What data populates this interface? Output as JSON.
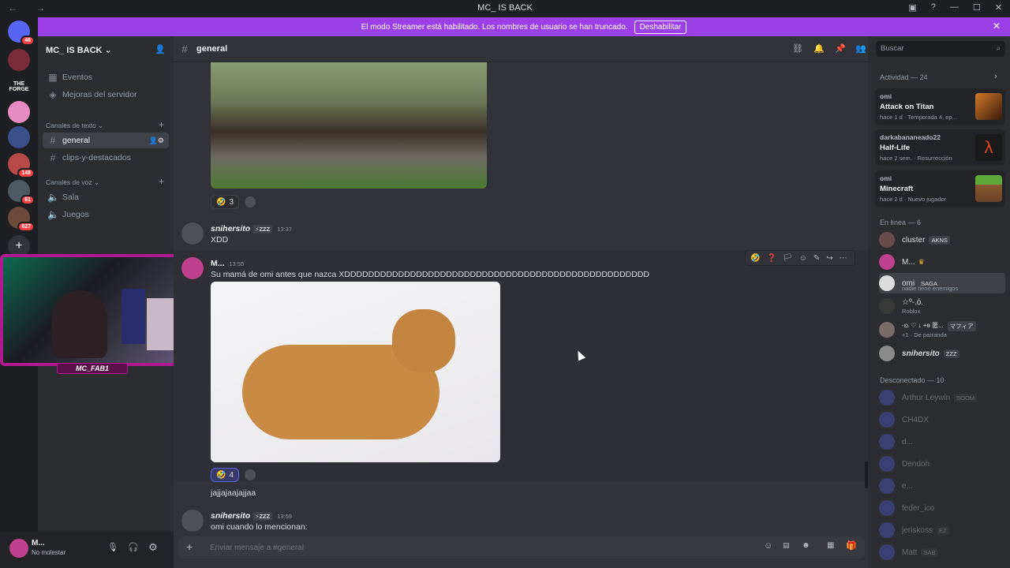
{
  "titlebar": {
    "title": "MC_ IS BACK",
    "nav": "← →"
  },
  "banner": {
    "text": "El modo Streamer está habilitado. Los nombres de usuario se han truncado.",
    "button": "Deshabilitar",
    "close": "✕"
  },
  "servers": [
    {
      "name": "home",
      "badge": "46"
    },
    {
      "name": "server-2",
      "badge": ""
    },
    {
      "name": "the-forge",
      "badge": "",
      "label": "THE FORGE"
    },
    {
      "name": "server-4",
      "badge": ""
    },
    {
      "name": "server-5",
      "badge": ""
    },
    {
      "name": "server-6",
      "badge": "148"
    },
    {
      "name": "server-7",
      "badge": "61"
    },
    {
      "name": "server-8",
      "badge": "627"
    }
  ],
  "sidebar": {
    "server_name": "MC_ IS BACK",
    "top_items": [
      {
        "label": "Eventos"
      },
      {
        "label": "Mejoras del servidor"
      }
    ],
    "text_category": "Canales de texto",
    "text_channels": [
      {
        "label": "general",
        "active": true
      },
      {
        "label": "clips-y-destacados",
        "active": false
      }
    ],
    "voice_category": "Canales de voz",
    "voice_channels": [
      {
        "label": "Sala"
      },
      {
        "label": "Juegos"
      }
    ]
  },
  "userbar": {
    "name": "M...",
    "status": "No molestar"
  },
  "stream_overlay": {
    "label": "MC_FAB1"
  },
  "chat": {
    "channel": "general",
    "reaction1": {
      "emoji": "🤣",
      "count": "3"
    },
    "msg1": {
      "author": "snihersito",
      "tag": "⚡ZZZ",
      "time": "13:37",
      "text": "XDD"
    },
    "msg2": {
      "author": "M...",
      "time": "13:55",
      "text": "Su mamá de omi antes que nazca XDDDDDDDDDDDDDDDDDDDDDDDDDDDDDDDDDDDDDDDDDDDDDDDDDDD"
    },
    "reaction2": {
      "emoji": "🤣",
      "count": "4"
    },
    "msg3": {
      "text": "jajjajaajajjaa"
    },
    "msg4": {
      "author": "snihersito",
      "tag": "⚡ZZZ",
      "time": "13:59",
      "text": "omi cuando lo mencionan:"
    },
    "composer_placeholder": "Enviar mensaje a #general"
  },
  "members": {
    "search_placeholder": "Buscar",
    "activity_label": "Actividad — 24",
    "activities": [
      {
        "user": "omi",
        "game": "Attack on Titan",
        "meta": "hace 1 d · Temporada 4, ep..."
      },
      {
        "user": "darkabananeado22",
        "game": "Half-Life",
        "meta": "hace 2 sem. · Resurrección"
      },
      {
        "user": "omi",
        "game": "Minecraft",
        "meta": "hace 2 d · Nuevo jugador"
      }
    ],
    "online_label": "En línea — 6",
    "online": [
      {
        "name": "cluster",
        "tag": "AKNS",
        "status": ""
      },
      {
        "name": "M...",
        "tag": "",
        "status": ""
      },
      {
        "name": "omi",
        "tag": "SAGA",
        "status": "nadie tiene enemigos"
      },
      {
        "name": "☆º-.ό.",
        "tag": "",
        "status": "Roblox"
      },
      {
        "name": "-ᨳ ♡ ↓ +ө 匿...",
        "tag": "マフィア",
        "status": "+1 · De parranda"
      },
      {
        "name": "snihersito",
        "tag": "ZZZ",
        "status": ""
      }
    ],
    "offline_label": "Desconectado — 10",
    "offline": [
      {
        "name": "Arthur Leywin",
        "tag": "BOOM"
      },
      {
        "name": "CH4DX",
        "tag": ""
      },
      {
        "name": "d...",
        "tag": ""
      },
      {
        "name": "Dendoh",
        "tag": ""
      },
      {
        "name": "e...",
        "tag": ""
      },
      {
        "name": "feder_ico",
        "tag": ""
      },
      {
        "name": "jeriskoss",
        "tag": "EZ"
      },
      {
        "name": "Matt",
        "tag": "SAB"
      }
    ]
  },
  "colors": {
    "accent": "#5865f2",
    "banner": "#9b3fe6",
    "danger": "#f23f43",
    "online": "#23a55a"
  }
}
